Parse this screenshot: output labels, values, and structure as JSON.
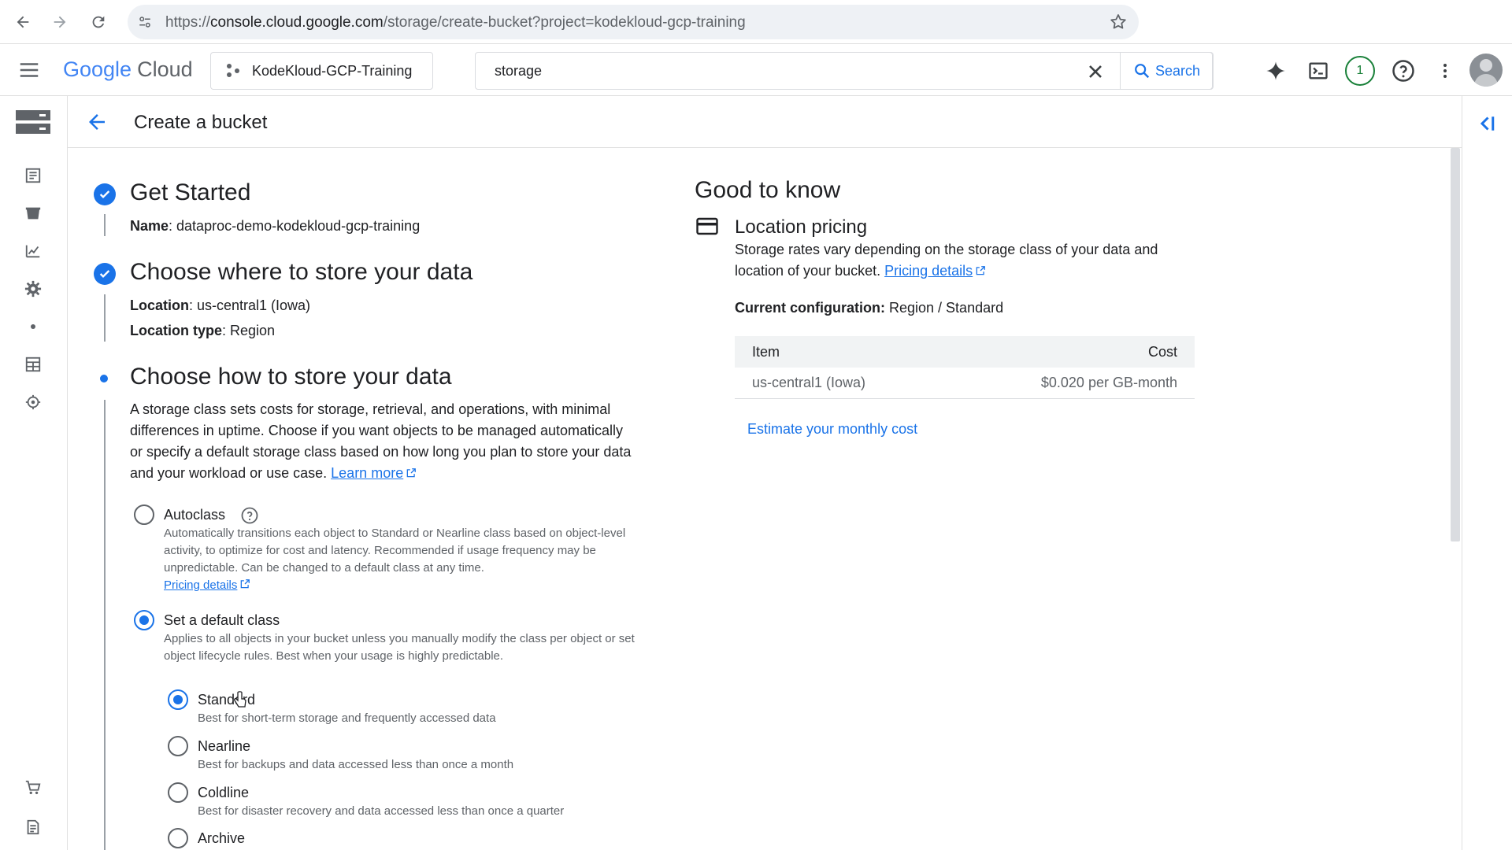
{
  "browser": {
    "url_prefix": "https://",
    "url_domain": "console.cloud.google.com",
    "url_path": "/storage/create-bucket?project=kodekloud-gcp-training"
  },
  "header": {
    "logo_google": "Google",
    "logo_cloud": "Cloud",
    "project": "KodeKloud-GCP-Training",
    "search_value": "storage",
    "search_button": "Search",
    "notification_count": "1"
  },
  "page": {
    "title": "Create a bucket"
  },
  "steps": {
    "get_started": {
      "title": "Get Started",
      "name_label": "Name",
      "name_value": ": dataproc-demo-kodekloud-gcp-training"
    },
    "where": {
      "title": "Choose where to store your data",
      "location_label": "Location",
      "location_value": ": us-central1 (Iowa)",
      "location_type_label": "Location type",
      "location_type_value": ": Region"
    },
    "how": {
      "title": "Choose how to store your data",
      "description": "A storage class sets costs for storage, retrieval, and operations, with minimal differences in uptime. Choose if you want objects to be managed automatically or specify a default storage class based on how long you plan to store your data and your workload or use case.",
      "learn_more": "Learn more",
      "autoclass_label": "Autoclass",
      "autoclass_desc": "Automatically transitions each object to Standard or Nearline class based on object-level activity, to optimize for cost and latency. Recommended if usage frequency may be unpredictable. Can be changed to a default class at any time.",
      "autoclass_pricing": "Pricing details",
      "default_label": "Set a default class",
      "default_desc": "Applies to all objects in your bucket unless you manually modify the class per object or set object lifecycle rules. Best when your usage is highly predictable.",
      "classes": [
        {
          "label": "Standard",
          "desc": "Best for short-term storage and frequently accessed data",
          "selected": true
        },
        {
          "label": "Nearline",
          "desc": "Best for backups and data accessed less than once a month",
          "selected": false
        },
        {
          "label": "Coldline",
          "desc": "Best for disaster recovery and data accessed less than once a quarter",
          "selected": false
        },
        {
          "label": "Archive",
          "desc": "",
          "selected": false
        }
      ]
    }
  },
  "good_to_know": {
    "title": "Good to know",
    "location_pricing_title": "Location pricing",
    "location_pricing_text": "Storage rates vary depending on the storage class of your data and location of your bucket.",
    "pricing_details": "Pricing details",
    "current_config_label": "Current configuration:",
    "current_config_value": " Region / Standard",
    "table": {
      "col_item": "Item",
      "col_cost": "Cost",
      "row_item": "us-central1 (Iowa)",
      "row_cost": "$0.020 per GB-month"
    },
    "estimate": "Estimate your monthly cost"
  },
  "colors": {
    "accent": "#1a73e8",
    "text": "#202124",
    "secondary_text": "#5f6368",
    "notification": "#188038"
  }
}
